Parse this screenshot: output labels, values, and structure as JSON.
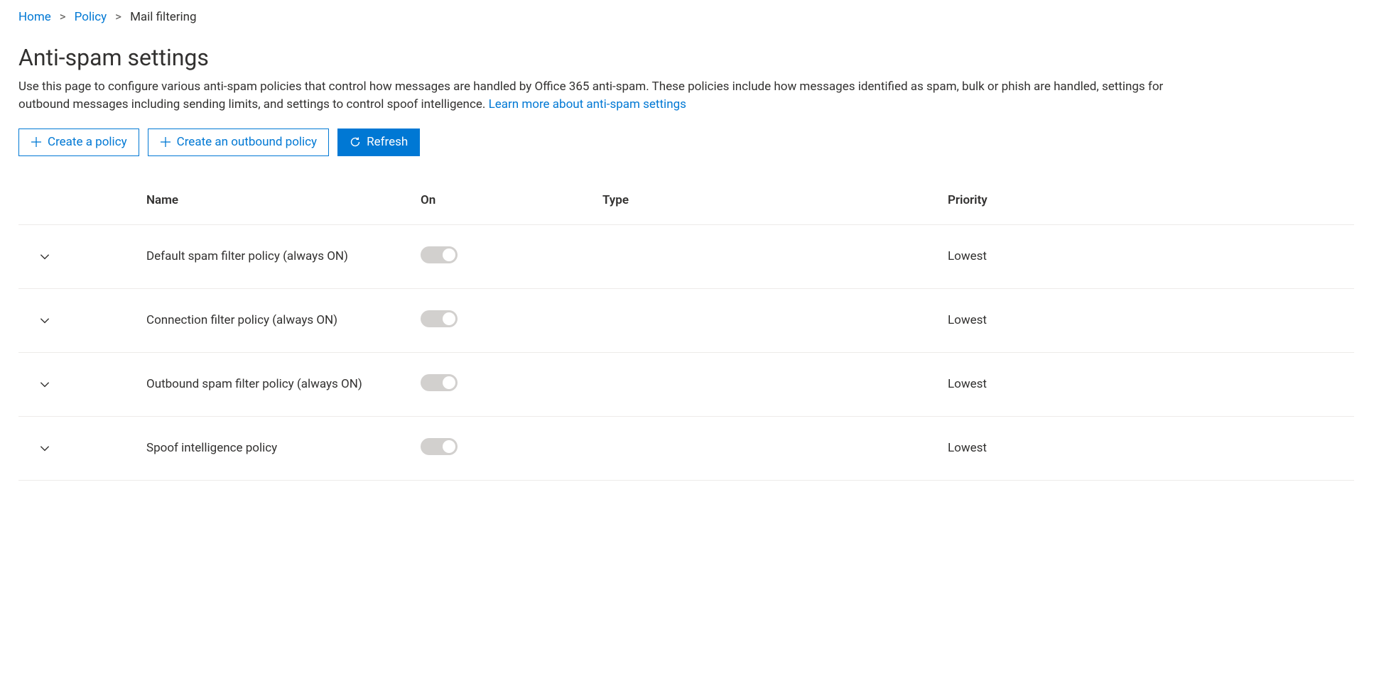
{
  "breadcrumb": {
    "items": [
      {
        "label": "Home",
        "link": true
      },
      {
        "label": "Policy",
        "link": true
      },
      {
        "label": "Mail filtering",
        "link": false
      }
    ],
    "separator": ">"
  },
  "header": {
    "title": "Anti-spam settings",
    "description": "Use this page to configure various anti-spam policies that control how messages are handled by Office 365 anti-spam. These policies include how messages identified as spam, bulk or phish are handled, settings for outbound messages including sending limits, and settings to control spoof intelligence. ",
    "learn_more": "Learn more about anti-spam settings"
  },
  "actions": {
    "create_policy": "Create a policy",
    "create_outbound": "Create an outbound policy",
    "refresh": "Refresh"
  },
  "table": {
    "columns": {
      "name": "Name",
      "on": "On",
      "type": "Type",
      "priority": "Priority"
    },
    "rows": [
      {
        "name": "Default spam filter policy (always ON)",
        "on": true,
        "type": "",
        "priority": "Lowest"
      },
      {
        "name": "Connection filter policy (always ON)",
        "on": true,
        "type": "",
        "priority": "Lowest"
      },
      {
        "name": "Outbound spam filter policy (always ON)",
        "on": true,
        "type": "",
        "priority": "Lowest"
      },
      {
        "name": "Spoof intelligence policy",
        "on": true,
        "type": "",
        "priority": "Lowest"
      }
    ]
  }
}
